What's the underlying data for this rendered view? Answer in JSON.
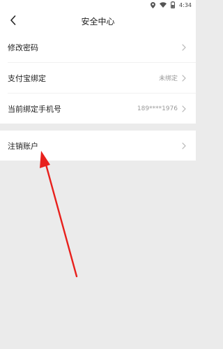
{
  "status_bar": {
    "time": "4:34",
    "icons": [
      "location-icon",
      "wifi-icon",
      "battery-icon"
    ]
  },
  "header": {
    "title": "安全中心",
    "back_icon": "chevron-left-icon"
  },
  "settings": {
    "items": [
      {
        "label": "修改密码",
        "value": ""
      },
      {
        "label": "支付宝绑定",
        "value": "未绑定"
      },
      {
        "label": "当前绑定手机号",
        "value": "189****1976"
      }
    ],
    "danger": {
      "label": "注销账户",
      "value": ""
    }
  },
  "annotation": {
    "arrow_color": "#e8201c"
  }
}
